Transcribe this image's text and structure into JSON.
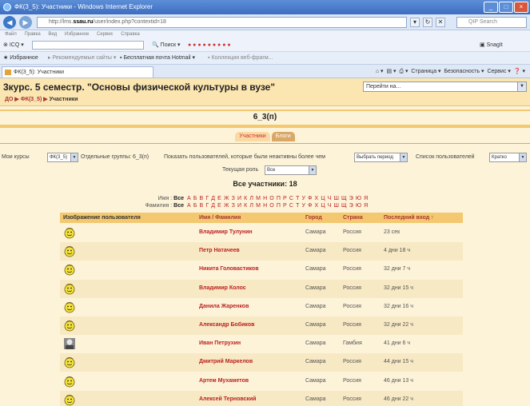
{
  "browser": {
    "title": "ФК(3_5): Участники - Windows Internet Explorer",
    "url_prefix": "http://lms.",
    "url_domain": "ssau.ru",
    "url_path": "/user/index.php?contextid=18",
    "search_placeholder": "QIP Search",
    "menu": [
      "Файл",
      "Правка",
      "Вид",
      "Избранное",
      "Сервис",
      "Справка"
    ],
    "toolbar_search": "Поиск",
    "toolbar_icq": "ICQ",
    "snagit": "SnagIt",
    "favorites_label": "Избранное",
    "fav_items": [
      "Рекомендуемые сайты",
      "Бесплатная почта Hotmail",
      "Коллекция веб-фрагм..."
    ],
    "tab_label": "ФК(3_5): Участники",
    "cmd_items": [
      "Страница",
      "Безопасность",
      "Сервис"
    ]
  },
  "course": {
    "title": "3курс. 5 семестр. \"Основы физической культуры в вузе\"",
    "jump_label": "Перейти на...",
    "breadcrumb": [
      "ДО",
      "ФК(3_5)",
      "Участники"
    ]
  },
  "group": {
    "title": "6_3(п)",
    "tabs": [
      "Участники",
      "Блоги"
    ]
  },
  "filters": {
    "my_courses_label": "Мои курсы",
    "my_courses_value": "ФК(3_5)",
    "groups_label": "Отдельные группы: 6_3(п)",
    "inactive_label": "Показать пользователей, которые были неактивны более чем",
    "inactive_value": "Выбрать период",
    "list_label": "Список пользователей",
    "list_value": "Кратко",
    "role_label": "Текущая роль",
    "role_value": "Все"
  },
  "summary": {
    "all_participants": "Все участники: 18"
  },
  "alphabet": {
    "name_label": "Имя :",
    "surname_label": "Фамилия :",
    "all": "Все",
    "letters": "А Б В Г Д Е Ж З И К Л М Н О П Р С Т У Ф Х Ц Ч Ш Щ Э Ю Я"
  },
  "table": {
    "headers": [
      "Изображение пользователя",
      "Имя / Фамилия",
      "Город",
      "Страна",
      "Последний вход ↑"
    ],
    "rows": [
      {
        "name": "Владимир Тулунин",
        "city": "Самара",
        "country": "Россия",
        "last": "23 сек",
        "avatar": "smiley-icon"
      },
      {
        "name": "Петр Натачеев",
        "city": "Самара",
        "country": "Россия",
        "last": "4 дни 18 ч",
        "avatar": "smiley-icon"
      },
      {
        "name": "Никита Головастиков",
        "city": "Самара",
        "country": "Россия",
        "last": "32 дни 7 ч",
        "avatar": "smiley-icon"
      },
      {
        "name": "Владимир Колос",
        "city": "Самара",
        "country": "Россия",
        "last": "32 дни 15 ч",
        "avatar": "smiley-icon"
      },
      {
        "name": "Данила Жаренков",
        "city": "Самара",
        "country": "Россия",
        "last": "32 дни 16 ч",
        "avatar": "smiley-icon"
      },
      {
        "name": "Александр Бобиков",
        "city": "Самара",
        "country": "Россия",
        "last": "32 дни 22 ч",
        "avatar": "smiley-icon"
      },
      {
        "name": "Иван Петрухин",
        "city": "Самара",
        "country": "Гамбия",
        "last": "41 дни 6 ч",
        "avatar": "photo-icon"
      },
      {
        "name": "Дмитрий Маркелов",
        "city": "Самара",
        "country": "Россия",
        "last": "44 дни 15 ч",
        "avatar": "smiley-icon"
      },
      {
        "name": "Артем Мухаметов",
        "city": "Самара",
        "country": "Россия",
        "last": "46 дни 13 ч",
        "avatar": "smiley-icon"
      },
      {
        "name": "Алексей Терновский",
        "city": "Самара",
        "country": "Россия",
        "last": "46 дни 22 ч",
        "avatar": "smiley-icon"
      }
    ]
  }
}
